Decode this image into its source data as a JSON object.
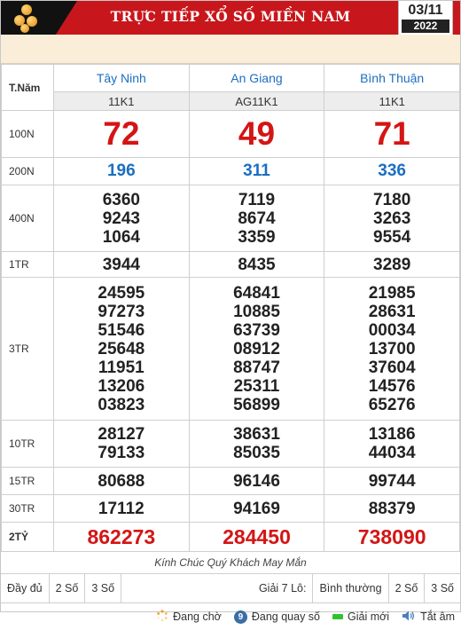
{
  "header": {
    "title": "TRỰC TIẾP XỔ SỐ MIỀN NAM",
    "date_day": "03/11",
    "date_year": "2022"
  },
  "table": {
    "label_header": "T.Năm",
    "provinces": [
      {
        "name": "Tây Ninh",
        "code": "11K1"
      },
      {
        "name": "An Giang",
        "code": "AG11K1"
      },
      {
        "name": "Bình Thuận",
        "code": "11K1"
      }
    ],
    "prizes": [
      {
        "label": "100N",
        "style": "n100",
        "values": [
          [
            "72"
          ],
          [
            "49"
          ],
          [
            "71"
          ]
        ]
      },
      {
        "label": "200N",
        "style": "n200",
        "values": [
          [
            "196"
          ],
          [
            "311"
          ],
          [
            "336"
          ]
        ]
      },
      {
        "label": "400N",
        "style": "num",
        "values": [
          [
            "6360",
            "9243",
            "1064"
          ],
          [
            "7119",
            "8674",
            "3359"
          ],
          [
            "7180",
            "3263",
            "9554"
          ]
        ]
      },
      {
        "label": "1TR",
        "style": "num",
        "values": [
          [
            "3944"
          ],
          [
            "8435"
          ],
          [
            "3289"
          ]
        ]
      },
      {
        "label": "3TR",
        "style": "num",
        "values": [
          [
            "24595",
            "97273",
            "51546",
            "25648",
            "11951",
            "13206",
            "03823"
          ],
          [
            "64841",
            "10885",
            "63739",
            "08912",
            "88747",
            "25311",
            "56899"
          ],
          [
            "21985",
            "28631",
            "00034",
            "13700",
            "37604",
            "14576",
            "65276"
          ]
        ]
      },
      {
        "label": "10TR",
        "style": "num",
        "values": [
          [
            "28127",
            "79133"
          ],
          [
            "38631",
            "85035"
          ],
          [
            "13186",
            "44034"
          ]
        ]
      },
      {
        "label": "15TR",
        "style": "num",
        "values": [
          [
            "80688"
          ],
          [
            "96146"
          ],
          [
            "99744"
          ]
        ]
      },
      {
        "label": "30TR",
        "style": "num",
        "values": [
          [
            "17112"
          ],
          [
            "94169"
          ],
          [
            "88379"
          ]
        ]
      },
      {
        "label": "2TỶ",
        "style": "jack",
        "values": [
          [
            "862273"
          ],
          [
            "284450"
          ],
          [
            "738090"
          ]
        ]
      }
    ]
  },
  "footer": {
    "wish": "Kính Chúc Quý Khách May Mắn",
    "options": {
      "full": "Đầy đủ",
      "two_digits": "2 Số",
      "three_digits": "3 Số",
      "prize7_label": "Giải 7 Lô:",
      "normal": "Bình thường",
      "two_digits_b": "2 Số",
      "three_digits_b": "3 Số"
    },
    "legend": {
      "waiting": "Đang chờ",
      "spinning": "Đang quay số",
      "spinning_badge": "9",
      "new_prize": "Giải mới",
      "sound_off": "Tắt âm"
    }
  },
  "colors": {
    "header_red": "#c8171c",
    "number_red": "#d41515",
    "province_blue": "#1b6fc0",
    "cream": "#fbeed9"
  }
}
